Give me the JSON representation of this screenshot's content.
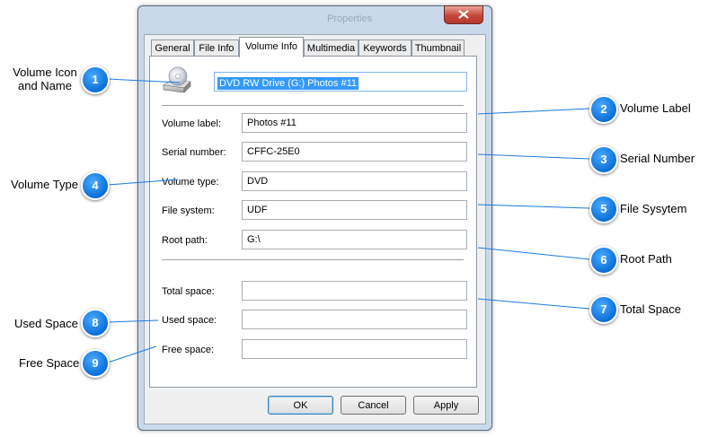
{
  "window": {
    "title": "Properties"
  },
  "tabs": [
    {
      "label": "General"
    },
    {
      "label": "File Info"
    },
    {
      "label": "Volume Info",
      "active": true
    },
    {
      "label": "Multimedia"
    },
    {
      "label": "Keywords"
    },
    {
      "label": "Thumbnail"
    }
  ],
  "volume": {
    "icon": "dvd-drive-icon",
    "name": "DVD RW Drive (G:) Photos #11"
  },
  "fields": {
    "volume_label": {
      "label": "Volume label:",
      "value": "Photos #11"
    },
    "serial_number": {
      "label": "Serial number:",
      "value": "CFFC-25E0"
    },
    "volume_type": {
      "label": "Volume type:",
      "value": "DVD"
    },
    "file_system": {
      "label": "File system:",
      "value": "UDF"
    },
    "root_path": {
      "label": "Root path:",
      "value": "G:\\"
    },
    "total_space": {
      "label": "Total space:",
      "value": ""
    },
    "used_space": {
      "label": "Used space:",
      "value": ""
    },
    "free_space": {
      "label": "Free space:",
      "value": ""
    }
  },
  "buttons": {
    "ok": "OK",
    "cancel": "Cancel",
    "apply": "Apply"
  },
  "callouts": [
    {
      "number": "1",
      "text_line1": "Volume Icon",
      "text_line2": "and Name"
    },
    {
      "number": "2",
      "text": "Volume Label"
    },
    {
      "number": "3",
      "text": "Serial Number"
    },
    {
      "number": "4",
      "text": "Volume Type"
    },
    {
      "number": "5",
      "text": "File Sysytem"
    },
    {
      "number": "6",
      "text": "Root Path"
    },
    {
      "number": "7",
      "text": "Total Space"
    },
    {
      "number": "8",
      "text": "Used Space"
    },
    {
      "number": "9",
      "text": "Free Space"
    }
  ],
  "colors": {
    "callout_badge": "#0a6fd8",
    "selection": "#3399ff",
    "callout_line": "#1b7be0"
  }
}
